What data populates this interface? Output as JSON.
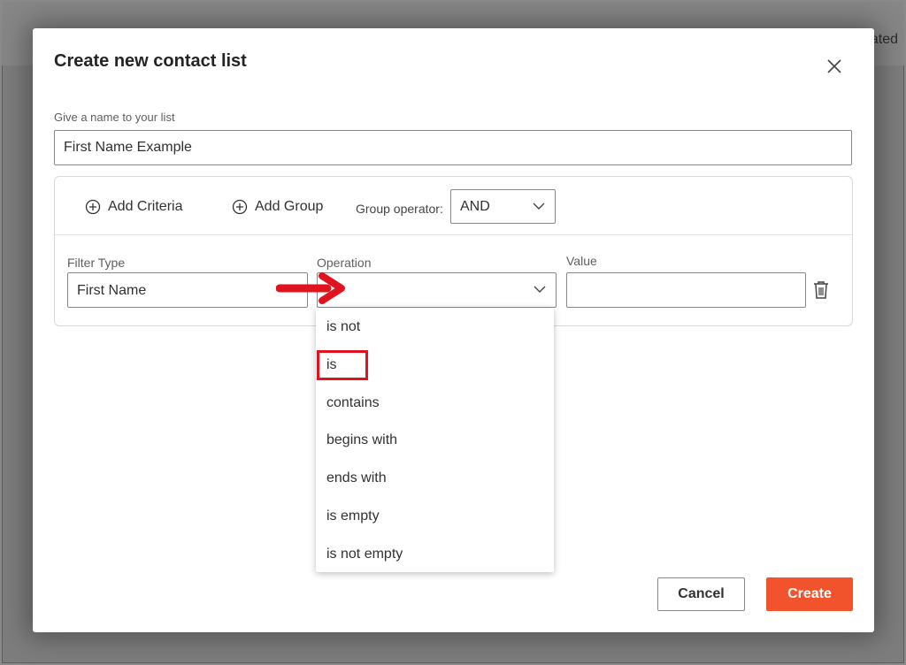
{
  "background": {
    "partial_text": "dated"
  },
  "modal": {
    "title": "Create new contact list",
    "name_label": "Give a name to your list",
    "name_value": "First Name Example"
  },
  "toolbar": {
    "add_criteria": "Add Criteria",
    "add_group": "Add Group",
    "group_operator_label": "Group operator:",
    "group_operator_value": "AND"
  },
  "criteria_row": {
    "filter_type_label": "Filter Type",
    "filter_type_value": "First Name",
    "operation_label": "Operation",
    "operation_value": "",
    "value_label": "Value",
    "value_value": ""
  },
  "operation_options": [
    "is not",
    "is",
    "contains",
    "begins with",
    "ends with",
    "is empty",
    "is not empty"
  ],
  "highlighted_option": "is",
  "buttons": {
    "cancel": "Cancel",
    "create": "Create"
  },
  "colors": {
    "accent": "#f1542c",
    "annotation_red": "#e0141e",
    "border": "#8a8886"
  },
  "icons": [
    "close-icon",
    "plus-circle-icon",
    "chevron-down-icon",
    "trash-icon",
    "red-arrow-annotation"
  ]
}
